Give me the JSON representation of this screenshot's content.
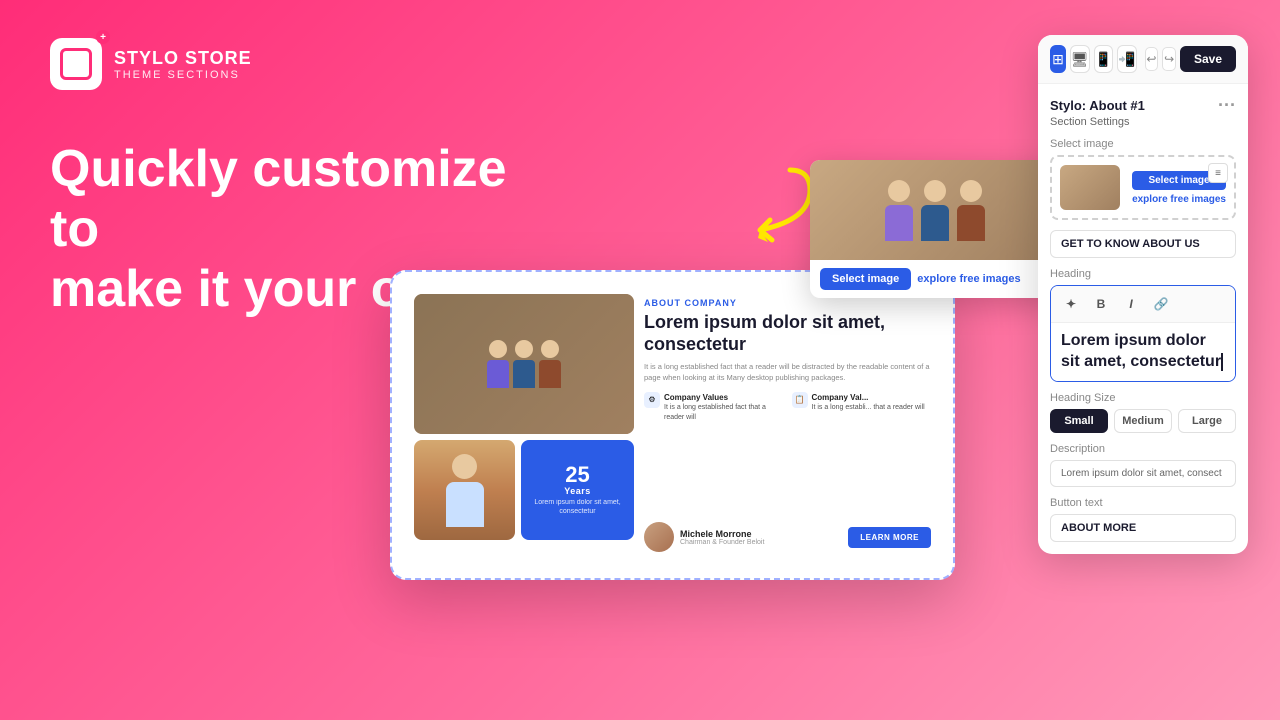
{
  "brand": {
    "name": "STYLO STORE",
    "subtitle": "THEME SECTIONS",
    "icon_plus": "+"
  },
  "headline": {
    "line1": "Quickly customize to",
    "line2": "make it your own!"
  },
  "panel": {
    "section_title": "Stylo: About #1",
    "section_settings": "Section Settings",
    "more_dots": "···",
    "save_label": "Save",
    "undo": "↩",
    "redo": "↪",
    "select_image_label": "Select image",
    "select_image_btn": "Select image",
    "explore_btn": "explore free images",
    "tag_value": "GET TO KNOW ABOUT US",
    "heading_label": "Heading",
    "heading_text_line1": "Lorem ipsum dolor",
    "heading_text_line2": "sit amet, consectetur",
    "heading_size_label": "Heading Size",
    "heading_sizes": [
      "Small",
      "Medium",
      "Large"
    ],
    "heading_size_active": "Small",
    "description_label": "Description",
    "description_value": "Lorem ipsum dolor sit amet, consect",
    "button_text_label": "Button text",
    "button_text_value": "ABOUT MORE"
  },
  "preview": {
    "about_label": "ABOUT COMPANY",
    "heading": "Lorem ipsum dolor sit amet, consectetur",
    "description": "It is a long established fact that a reader will be distracted by the readable content of a page when looking at its Many desktop publishing packages.",
    "feature1_title": "Company Values",
    "feature1_desc": "It is a long established fact that a reader will",
    "feature2_title": "Company Val...",
    "feature2_desc": "It is a long establi... that a reader will",
    "person_name": "Michele Morrone",
    "person_title": "Chairman & Founder Beloit",
    "learn_btn": "LEARN MORE",
    "years": "25",
    "years_label": "Years",
    "years_desc": "Lorem ipsum dolor sit amet, consectetur"
  },
  "toolbar_icons": {
    "grid": "⊞",
    "desktop": "🖥",
    "tablet": "📱",
    "mobile": "📲",
    "settings": "⚙"
  },
  "popup": {
    "select_btn": "Select image",
    "explore_btn": "explore free images"
  }
}
